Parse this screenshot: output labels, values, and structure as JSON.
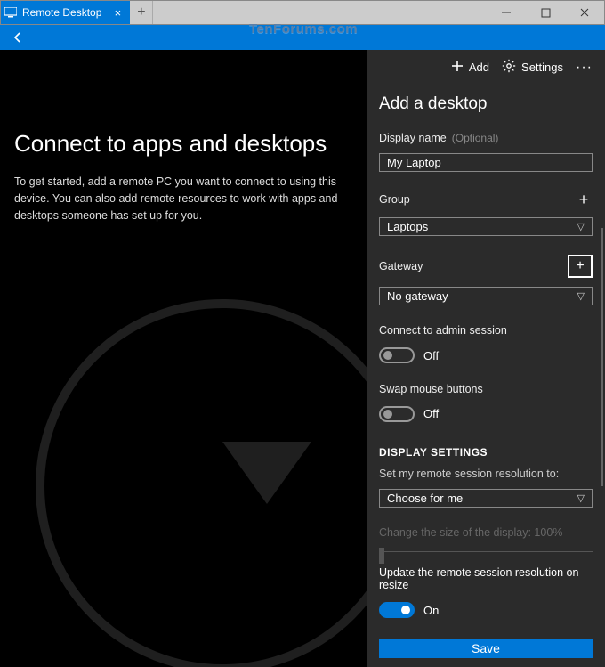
{
  "window": {
    "tab_title": "Remote Desktop",
    "watermark": "TenForums.com"
  },
  "toolbar": {
    "add_label": "Add",
    "settings_label": "Settings"
  },
  "main": {
    "heading": "Connect to apps and desktops",
    "body": "To get started, add a remote PC you want to connect to using this device. You can also add remote resources to work with apps and desktops someone has set up for you."
  },
  "panel": {
    "title": "Add a desktop",
    "display_name_label": "Display name",
    "optional_label": "(Optional)",
    "display_name_value": "My Laptop",
    "group_label": "Group",
    "group_value": "Laptops",
    "gateway_label": "Gateway",
    "gateway_value": "No gateway",
    "admin_label": "Connect to admin session",
    "admin_state": "Off",
    "swap_label": "Swap mouse buttons",
    "swap_state": "Off",
    "display_section": "DISPLAY SETTINGS",
    "resolution_label": "Set my remote session resolution to:",
    "resolution_value": "Choose for me",
    "scale_label": "Change the size of the display: 100%",
    "update_label": "Update the remote session resolution on resize",
    "update_state": "On",
    "save_label": "Save"
  }
}
